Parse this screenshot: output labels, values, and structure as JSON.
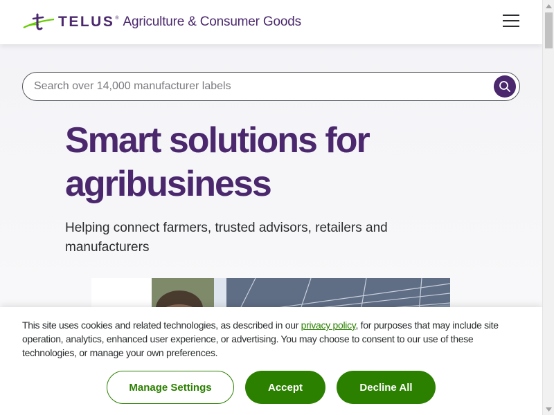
{
  "header": {
    "brand": "TELUS",
    "tagline": "Agriculture & Consumer Goods",
    "logo_icon": "telus-leaf-icon",
    "menu_icon": "hamburger-menu-icon"
  },
  "search": {
    "placeholder": "Search over 14,000 manufacturer labels",
    "value": "",
    "icon": "search-icon"
  },
  "hero": {
    "title": "Smart solutions for agribusiness",
    "subtitle": "Helping connect farmers, trusted advisors, retailers and manufacturers"
  },
  "cookie_banner": {
    "text_before": "This site uses cookies and related technologies, as described in our ",
    "link": "privacy policy",
    "text_after": ", for purposes that may include site operation, analytics, enhanced user experience, or advertising. You may choose to consent to our use of these technologies, or manage your own preferences.",
    "manage": "Manage Settings",
    "accept": "Accept",
    "decline": "Decline All"
  },
  "colors": {
    "brand_purple": "#4b286d",
    "brand_green": "#2b8000",
    "text": "#2a2c2e"
  }
}
